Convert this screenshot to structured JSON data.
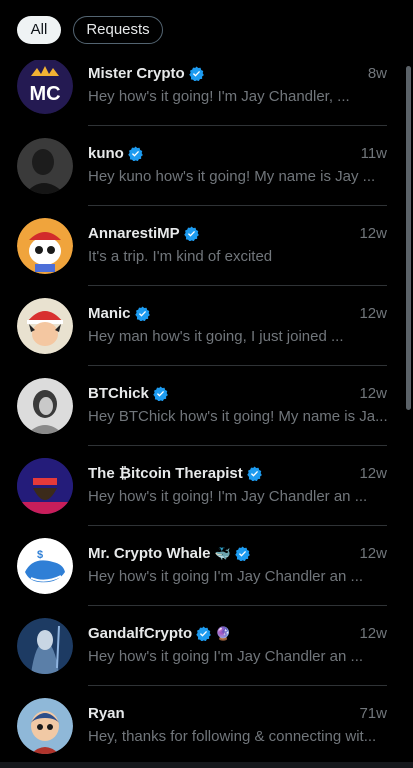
{
  "filters": {
    "all": "All",
    "requests": "Requests"
  },
  "colors": {
    "verified": "#1d9bf0",
    "muted": "#71767b",
    "background": "#000000"
  },
  "conversations": [
    {
      "name": "Mister Crypto",
      "time": "8w",
      "preview": "Hey how's it going! I'm Jay Chandler, ...",
      "verified": true,
      "avatar": "mister-crypto-logo"
    },
    {
      "name": "kuno",
      "time": "11w",
      "preview": "Hey kuno how's it going! My name is Jay ...",
      "verified": true,
      "avatar": "kuno-photo"
    },
    {
      "name": "AnnarestiMP",
      "time": "12w",
      "preview": "It's a trip.  I'm kind of excited",
      "verified": true,
      "avatar": "panda-avatar"
    },
    {
      "name": "Manic",
      "time": "12w",
      "preview": "Hey man how's it going, I just joined ...",
      "verified": true,
      "avatar": "trainer-avatar"
    },
    {
      "name": "BTChick",
      "time": "12w",
      "preview": "Hey BTChick how's it going! My name is Ja...",
      "verified": true,
      "avatar": "portrait-photo"
    },
    {
      "name": "The ₿itcoin Therapist",
      "time": "12w",
      "preview": "Hey how's it going! I'm Jay Chandler an ...",
      "verified": true,
      "avatar": "therapist-avatar"
    },
    {
      "name": "Mr. Crypto Whale",
      "emoji": "🐳",
      "time": "12w",
      "preview": "Hey how's it going I'm Jay Chandler an ...",
      "verified": true,
      "avatar": "whale-avatar"
    },
    {
      "name": "GandalfCrypto",
      "emoji": "🔮",
      "time": "12w",
      "preview": "Hey how's it going I'm Jay Chandler an ...",
      "verified": true,
      "avatar": "wizard-avatar"
    },
    {
      "name": "Ryan",
      "time": "71w",
      "preview": "Hey, thanks for following & connecting wit...",
      "verified": false,
      "avatar": "ryan-avatar"
    }
  ]
}
